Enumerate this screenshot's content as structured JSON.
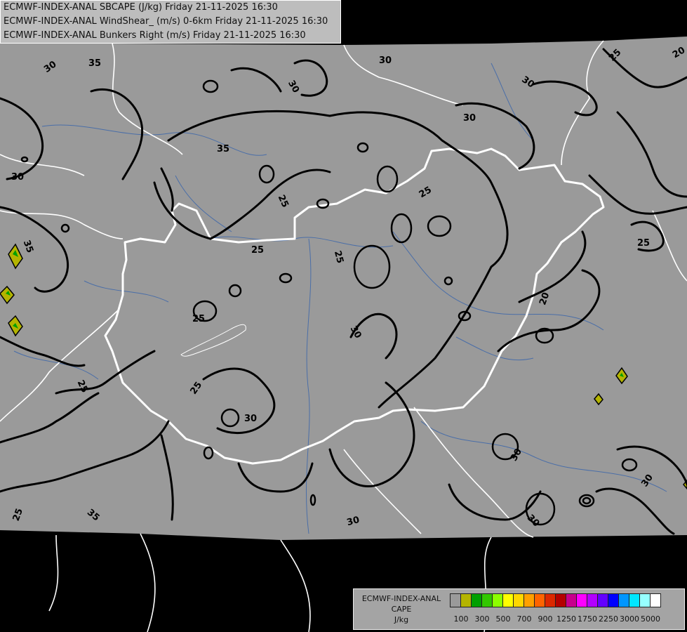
{
  "header": {
    "line1": "ECMWF-INDEX-ANAL SBCAPE (J/kg) Friday 21-11-2025 16:30",
    "line2": "ECMWF-INDEX-ANAL WindShear_ (m/s) 0-6km Friday 21-11-2025 16:30",
    "line3": "ECMWF-INDEX-ANAL Bunkers Right (m/s) Friday 21-11-2025 16:30"
  },
  "colors": {
    "background": "#000000",
    "data_area": "#9a9a9a",
    "contour": "#000000",
    "border": "#ffffff",
    "river": "#4a6ea8"
  },
  "contour_labels": [
    "30",
    "35",
    "30",
    "35",
    "30",
    "30",
    "30",
    "35",
    "25",
    "25",
    "25",
    "30",
    "25",
    "30",
    "25",
    "25",
    "25",
    "25",
    "25",
    "30",
    "30",
    "20",
    "30",
    "30",
    "25",
    "20",
    "30",
    "35",
    "25",
    "30",
    "25",
    "25"
  ],
  "legend": {
    "title_line1": "ECMWF-INDEX-ANAL",
    "title_line2": "CAPE",
    "title_line3": "J/kg",
    "colors": [
      "#9a9a9a",
      "#b4b400",
      "#00a000",
      "#32c800",
      "#8cff00",
      "#ffff00",
      "#ffd700",
      "#ffa000",
      "#ff6400",
      "#dc2800",
      "#b40000",
      "#c8008c",
      "#ff00ff",
      "#b400ff",
      "#6400ff",
      "#0000ff",
      "#0096ff",
      "#00e6ff",
      "#96ffff",
      "#ffffff"
    ],
    "tick_labels": [
      "100",
      "300",
      "500",
      "700",
      "900",
      "1250",
      "1750",
      "2250",
      "3000",
      "5000"
    ]
  }
}
